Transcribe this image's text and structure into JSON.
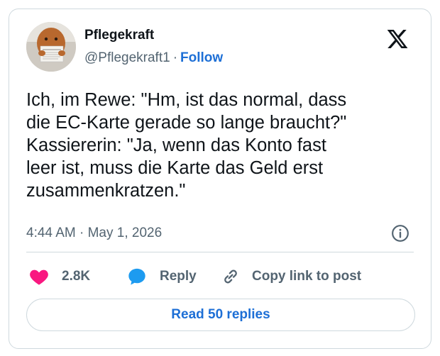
{
  "author": {
    "name": "Pflegekraft",
    "handle": "@Pflegekraft1",
    "separator": "·",
    "follow_label": "Follow"
  },
  "tweet": {
    "text": "Ich, im Rewe: \"Hm, ist das normal, dass\ndie EC-Karte gerade so lange braucht?\"\nKassiererin: \"Ja, wenn das Konto fast\nleer ist, muss die Karte das Geld erst\nzusammenkratzen.\"",
    "timestamp": "4:44 AM · May 1, 2026"
  },
  "actions": {
    "like_count": "2.8K",
    "reply_label": "Reply",
    "copy_label": "Copy link to post"
  },
  "read_replies_label": "Read 50 replies",
  "icons": {
    "logo": "x-logo-icon",
    "info": "info-icon",
    "like": "heart-icon",
    "reply": "speech-bubble-icon",
    "copy": "link-icon"
  },
  "colors": {
    "like": "#f91880",
    "reply": "#1d9bf0",
    "link": "#1d6fd6",
    "muted": "#536471"
  }
}
